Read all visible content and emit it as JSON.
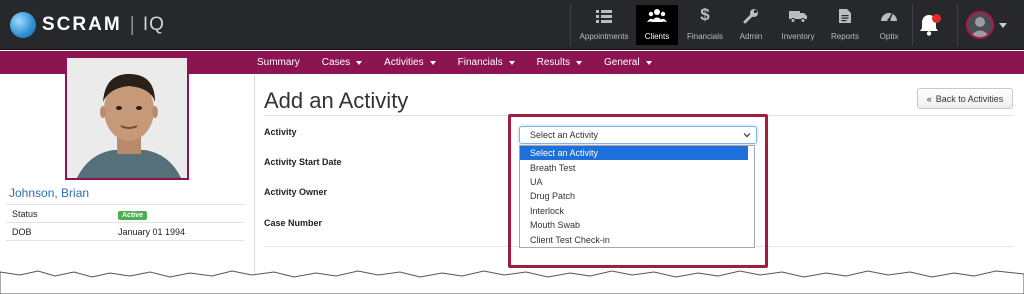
{
  "brand": {
    "name": "SCRAM",
    "suffix": "IQ"
  },
  "nav": [
    {
      "label": "Appointments",
      "icon": "list-icon",
      "active": false
    },
    {
      "label": "Clients",
      "icon": "users-icon",
      "active": true
    },
    {
      "label": "Financials",
      "icon": "dollar-icon",
      "active": false
    },
    {
      "label": "Admin",
      "icon": "wrench-icon",
      "active": false
    },
    {
      "label": "Inventory",
      "icon": "truck-icon",
      "active": false
    },
    {
      "label": "Reports",
      "icon": "document-icon",
      "active": false
    },
    {
      "label": "Optix",
      "icon": "gauge-icon",
      "active": false
    }
  ],
  "subnav": [
    {
      "label": "Summary",
      "dropdown": false
    },
    {
      "label": "Cases",
      "dropdown": true
    },
    {
      "label": "Activities",
      "dropdown": true
    },
    {
      "label": "Financials",
      "dropdown": true
    },
    {
      "label": "Results",
      "dropdown": true
    },
    {
      "label": "General",
      "dropdown": true
    }
  ],
  "client": {
    "name": "Johnson, Brian",
    "status_label": "Status",
    "status_value": "Active",
    "dob_label": "DOB",
    "dob_value": "January 01 1994"
  },
  "page": {
    "title": "Add an Activity",
    "back_button": "Back to Activities"
  },
  "form": {
    "activity_label": "Activity",
    "start_date_label": "Activity Start Date",
    "owner_label": "Activity Owner",
    "case_number_label": "Case Number",
    "activity_select_value": "Select an Activity",
    "activity_options": [
      "Select an Activity",
      "Breath Test",
      "UA",
      "Drug Patch",
      "Interlock",
      "Mouth Swab",
      "Client Test Check-in"
    ]
  },
  "colors": {
    "topbar": "#26282b",
    "accent": "#8d1452",
    "highlight": "#a11d3b",
    "selected_option": "#1e6fd9",
    "link": "#2a6ebb",
    "active_badge": "#4caf50"
  }
}
